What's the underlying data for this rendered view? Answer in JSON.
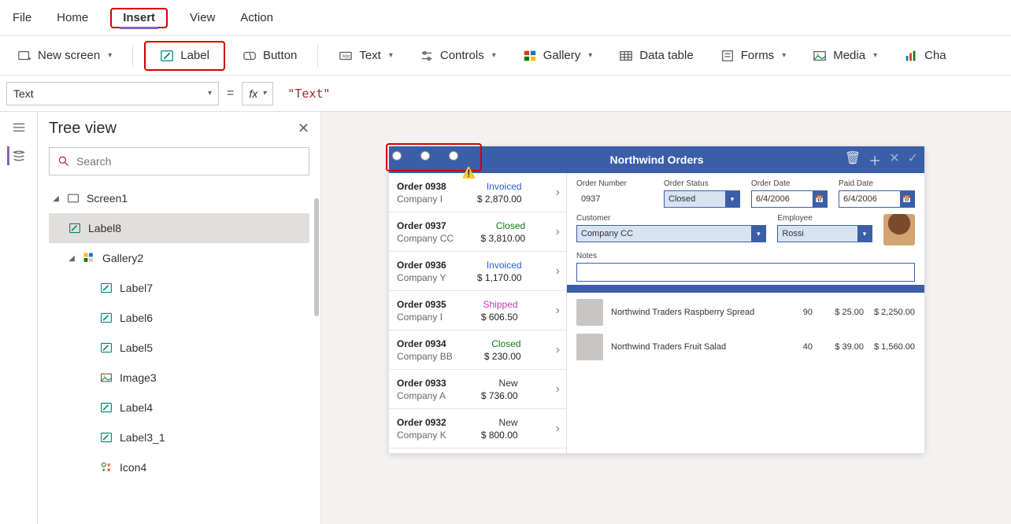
{
  "menu": {
    "file": "File",
    "home": "Home",
    "insert": "Insert",
    "view": "View",
    "action": "Action"
  },
  "ribbon": {
    "new_screen": "New screen",
    "label": "Label",
    "button": "Button",
    "text": "Text",
    "controls": "Controls",
    "gallery": "Gallery",
    "data_table": "Data table",
    "forms": "Forms",
    "media": "Media",
    "chart": "Cha"
  },
  "fx": {
    "prop": "Text",
    "eq": "=",
    "fx": "fx",
    "value": "\"Text\""
  },
  "tree": {
    "title": "Tree view",
    "search_ph": "Search",
    "items": [
      {
        "label": "Screen1",
        "type": "screen"
      },
      {
        "label": "Label8",
        "type": "label",
        "sel": true
      },
      {
        "label": "Gallery2",
        "type": "gallery"
      },
      {
        "label": "Label7",
        "type": "label"
      },
      {
        "label": "Label6",
        "type": "label"
      },
      {
        "label": "Label5",
        "type": "label"
      },
      {
        "label": "Image3",
        "type": "image"
      },
      {
        "label": "Label4",
        "type": "label"
      },
      {
        "label": "Label3_1",
        "type": "label"
      },
      {
        "label": "Icon4",
        "type": "icon"
      }
    ]
  },
  "app": {
    "title": "Northwind Orders",
    "orders": [
      {
        "num": "Order 0938",
        "co": "Company I",
        "status": "Invoiced",
        "amt": "$ 2,870.00",
        "cls": "st-invoiced"
      },
      {
        "num": "Order 0937",
        "co": "Company CC",
        "status": "Closed",
        "amt": "$ 3,810.00",
        "cls": "st-closed"
      },
      {
        "num": "Order 0936",
        "co": "Company Y",
        "status": "Invoiced",
        "amt": "$ 1,170.00",
        "cls": "st-invoiced"
      },
      {
        "num": "Order 0935",
        "co": "Company I",
        "status": "Shipped",
        "amt": "$ 606.50",
        "cls": "st-shipped"
      },
      {
        "num": "Order 0934",
        "co": "Company BB",
        "status": "Closed",
        "amt": "$ 230.00",
        "cls": "st-closed"
      },
      {
        "num": "Order 0933",
        "co": "Company A",
        "status": "New",
        "amt": "$ 736.00",
        "cls": "st-new"
      },
      {
        "num": "Order 0932",
        "co": "Company K",
        "status": "New",
        "amt": "$ 800.00",
        "cls": "st-new"
      }
    ],
    "detail": {
      "fields": {
        "ordnum_l": "Order Number",
        "ordnum": "0937",
        "status_l": "Order Status",
        "status": "Closed",
        "odate_l": "Order Date",
        "odate": "6/4/2006",
        "pdate_l": "Paid Date",
        "pdate": "6/4/2006",
        "cust_l": "Customer",
        "cust": "Company CC",
        "emp_l": "Employee",
        "emp": "Rossi",
        "notes_l": "Notes"
      },
      "lines": [
        {
          "name": "Northwind Traders Raspberry Spread",
          "q": "90",
          "p": "$ 25.00",
          "t": "$ 2,250.00"
        },
        {
          "name": "Northwind Traders Fruit Salad",
          "q": "40",
          "p": "$ 39.00",
          "t": "$ 1,560.00"
        }
      ]
    }
  }
}
